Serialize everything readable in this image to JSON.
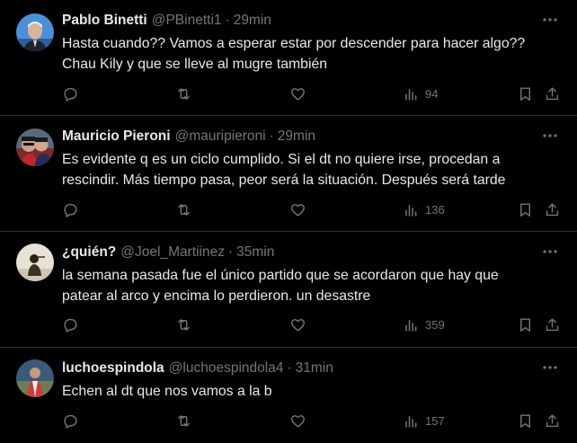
{
  "colors": {
    "background": "#000000",
    "text": "#e7e9ea",
    "muted": "#71767b",
    "divider": "#2f3336"
  },
  "icons": {
    "reply": "reply-icon",
    "retweet": "retweet-icon",
    "like": "like-icon",
    "views": "views-icon",
    "bookmark": "bookmark-icon",
    "share": "share-icon",
    "more": "more-icon"
  },
  "tweets": [
    {
      "name": "Pablo Binetti",
      "handle": "@PBinetti1",
      "separator": "·",
      "time": "29min",
      "lines": [
        "Hasta cuando?? Vamos a esperar estar por descender para hacer algo??",
        "Chau Kily y que se lleve al mugre también"
      ],
      "views": "94"
    },
    {
      "name": "Mauricio Pieroni",
      "handle": "@mauripieroni",
      "separator": "·",
      "time": "29min",
      "lines": [
        "Es evidente q es un ciclo cumplido. Si el dt no quiere irse, procedan a",
        "rescindir. Más tiempo pasa, peor será la situación. Después será tarde"
      ],
      "views": "136"
    },
    {
      "name": "¿quién?",
      "handle": "@Joel_Martiinez",
      "separator": "·",
      "time": "35min",
      "lines": [
        "la semana pasada fue el único partido que se acordaron que hay que",
        "patear al arco y encima lo perdieron. un desastre"
      ],
      "views": "359"
    },
    {
      "name": "luchoespindola",
      "handle": "@luchoespindola4",
      "separator": "·",
      "time": "31min",
      "lines": [
        "Echen al dt que nos vamos a la b"
      ],
      "views": "157"
    }
  ]
}
